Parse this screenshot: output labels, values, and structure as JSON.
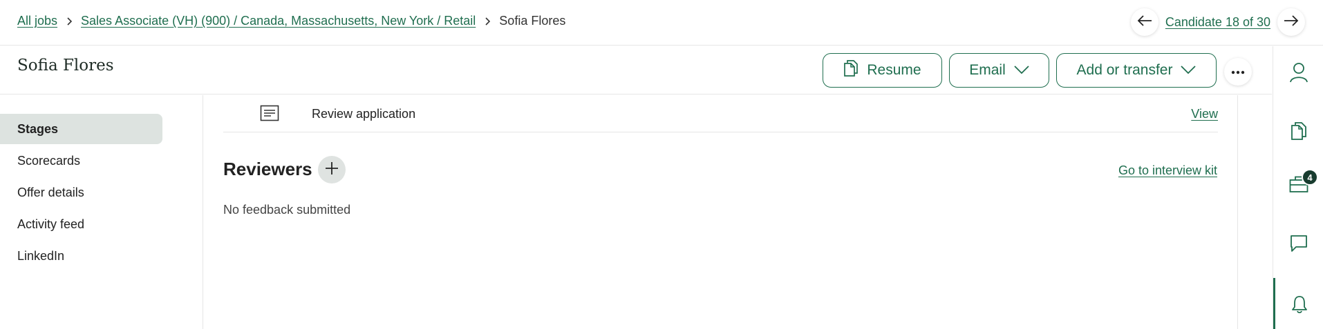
{
  "breadcrumb": {
    "all_jobs": "All jobs",
    "job": "Sales Associate (VH) (900) / Canada, Massachusetts, New York / Retail",
    "current": "Sofia Flores"
  },
  "candidate_nav": {
    "label": "Candidate 18 of 30",
    "prev_icon": "arrow-left-icon",
    "next_icon": "arrow-right-icon"
  },
  "header": {
    "name": "Sofia Flores",
    "resume_label": "Resume",
    "email_label": "Email",
    "add_transfer_label": "Add or transfer",
    "more_icon": "more-horizontal-icon"
  },
  "leftnav": {
    "items": [
      {
        "label": "Stages",
        "active": true
      },
      {
        "label": "Scorecards"
      },
      {
        "label": "Offer details"
      },
      {
        "label": "Activity feed"
      },
      {
        "label": "LinkedIn"
      }
    ]
  },
  "main": {
    "review_label": "Review application",
    "view_label": "View",
    "reviewers_title": "Reviewers",
    "interview_kit_label": "Go to interview kit",
    "no_feedback": "No feedback submitted"
  },
  "rail": {
    "items": [
      {
        "icon": "person-icon"
      },
      {
        "icon": "documents-icon"
      },
      {
        "icon": "briefcase-icon",
        "badge": "4"
      },
      {
        "icon": "chat-icon"
      },
      {
        "icon": "bell-icon",
        "active": true
      }
    ]
  },
  "colors": {
    "accent": "#1f6e4f",
    "active_nav_bg": "#dde3e0",
    "badge_bg": "#183c2f"
  }
}
